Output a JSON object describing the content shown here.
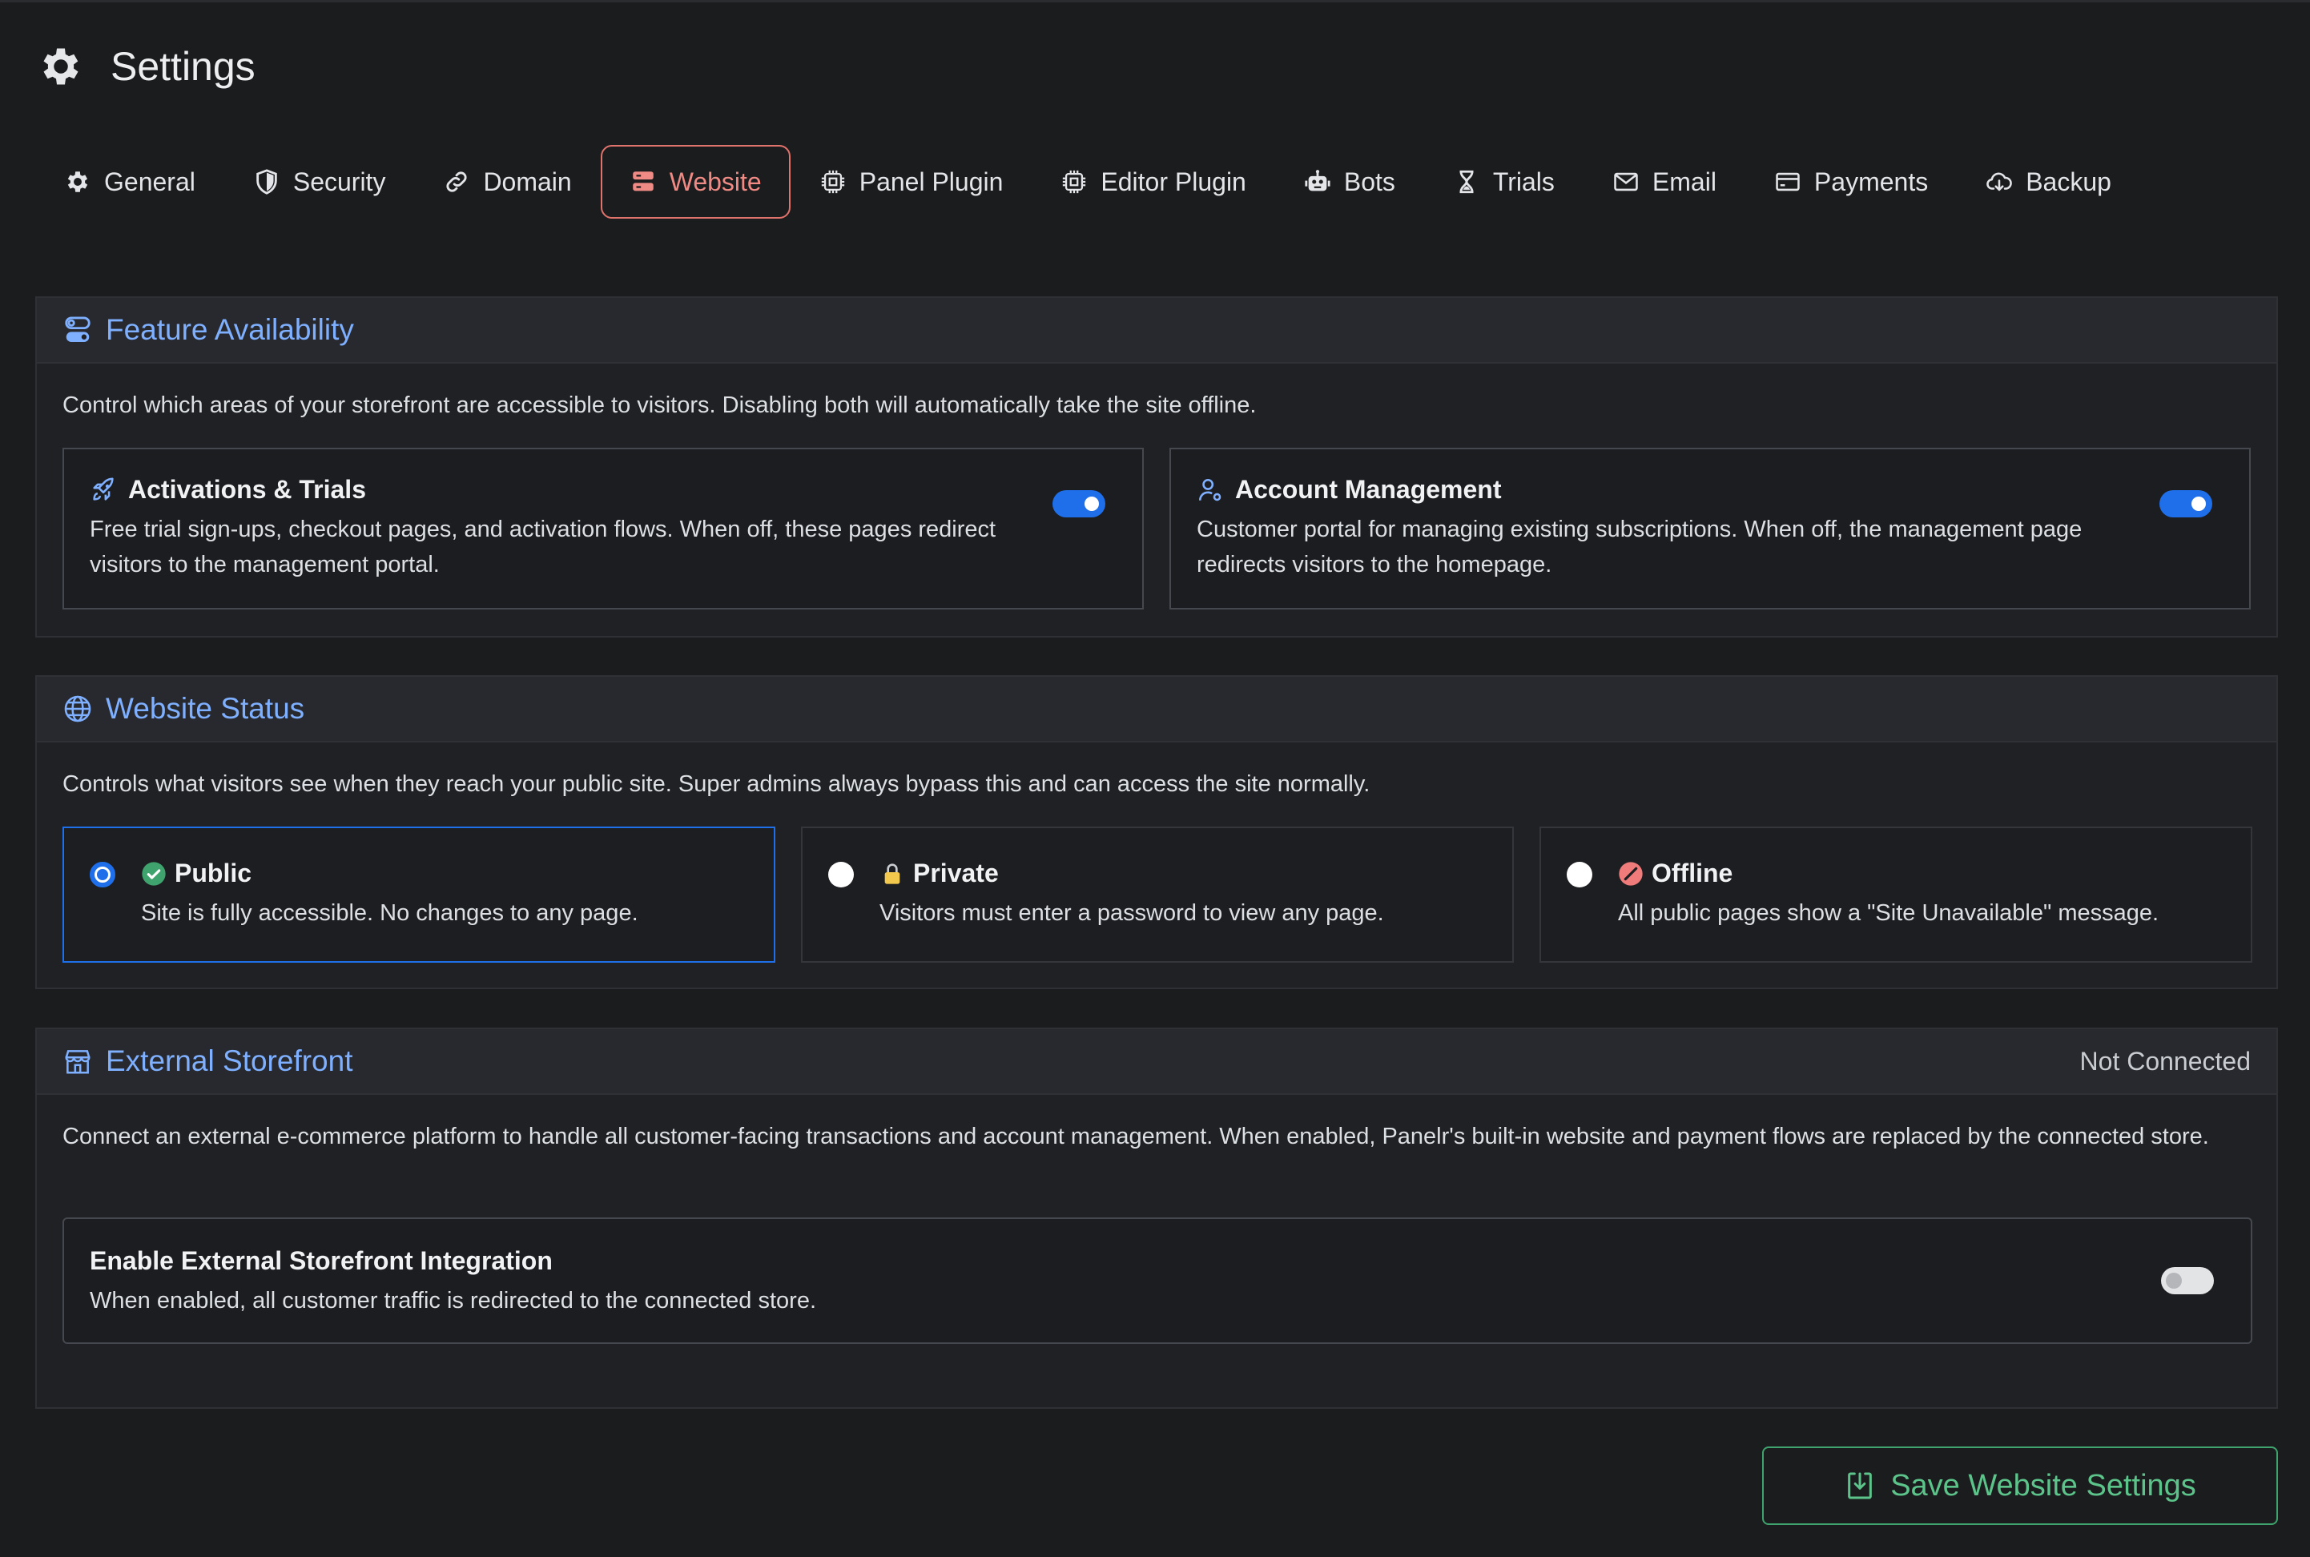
{
  "header": {
    "title": "Settings",
    "icon": "gear-icon"
  },
  "tabs": [
    {
      "label": "General",
      "icon": "gear-icon"
    },
    {
      "label": "Security",
      "icon": "shield-icon"
    },
    {
      "label": "Domain",
      "icon": "link-icon"
    },
    {
      "label": "Website",
      "icon": "server-icon",
      "active": true
    },
    {
      "label": "Panel Plugin",
      "icon": "chip-icon"
    },
    {
      "label": "Editor Plugin",
      "icon": "chip-icon"
    },
    {
      "label": "Bots",
      "icon": "robot-icon"
    },
    {
      "label": "Trials",
      "icon": "hourglass-icon"
    },
    {
      "label": "Email",
      "icon": "envelope-icon"
    },
    {
      "label": "Payments",
      "icon": "card-icon"
    },
    {
      "label": "Backup",
      "icon": "cloud-download-icon"
    }
  ],
  "feature": {
    "title": "Feature Availability",
    "description": "Control which areas of your storefront are accessible to visitors. Disabling both will automatically take the site offline.",
    "activations": {
      "title": "Activations & Trials",
      "description": "Free trial sign-ups, checkout pages, and activation flows. When off, these pages redirect visitors to the management portal.",
      "enabled": true
    },
    "account": {
      "title": "Account Management",
      "description": "Customer portal for managing existing subscriptions. When off, the management page redirects visitors to the homepage.",
      "enabled": true
    }
  },
  "status": {
    "title": "Website Status",
    "description": "Controls what visitors see when they reach your public site. Super admins always bypass this and can access the site normally.",
    "options": [
      {
        "label": "Public",
        "description": "Site is fully accessible. No changes to any page.",
        "selected": true
      },
      {
        "label": "Private",
        "description": "Visitors must enter a password to view any page.",
        "selected": false
      },
      {
        "label": "Offline",
        "description": "All public pages show a \"Site Unavailable\" message.",
        "selected": false
      }
    ]
  },
  "storefront": {
    "title": "External Storefront",
    "connection_status": "Not Connected",
    "description": "Connect an external e-commerce platform to handle all customer-facing transactions and account management. When enabled, Panelr's built-in website and payment flows are replaced by the connected store.",
    "integration_title": "Enable External Storefront Integration",
    "integration_description": "When enabled, all customer traffic is redirected to the connected store.",
    "enabled": false
  },
  "save_label": "Save Website Settings",
  "colors": {
    "accent_blue": "#1f6feb",
    "heading_blue": "#7fb0ff",
    "active_tab": "#e0736c",
    "save_green": "#3fa36d",
    "background": "#1b1c1e"
  }
}
